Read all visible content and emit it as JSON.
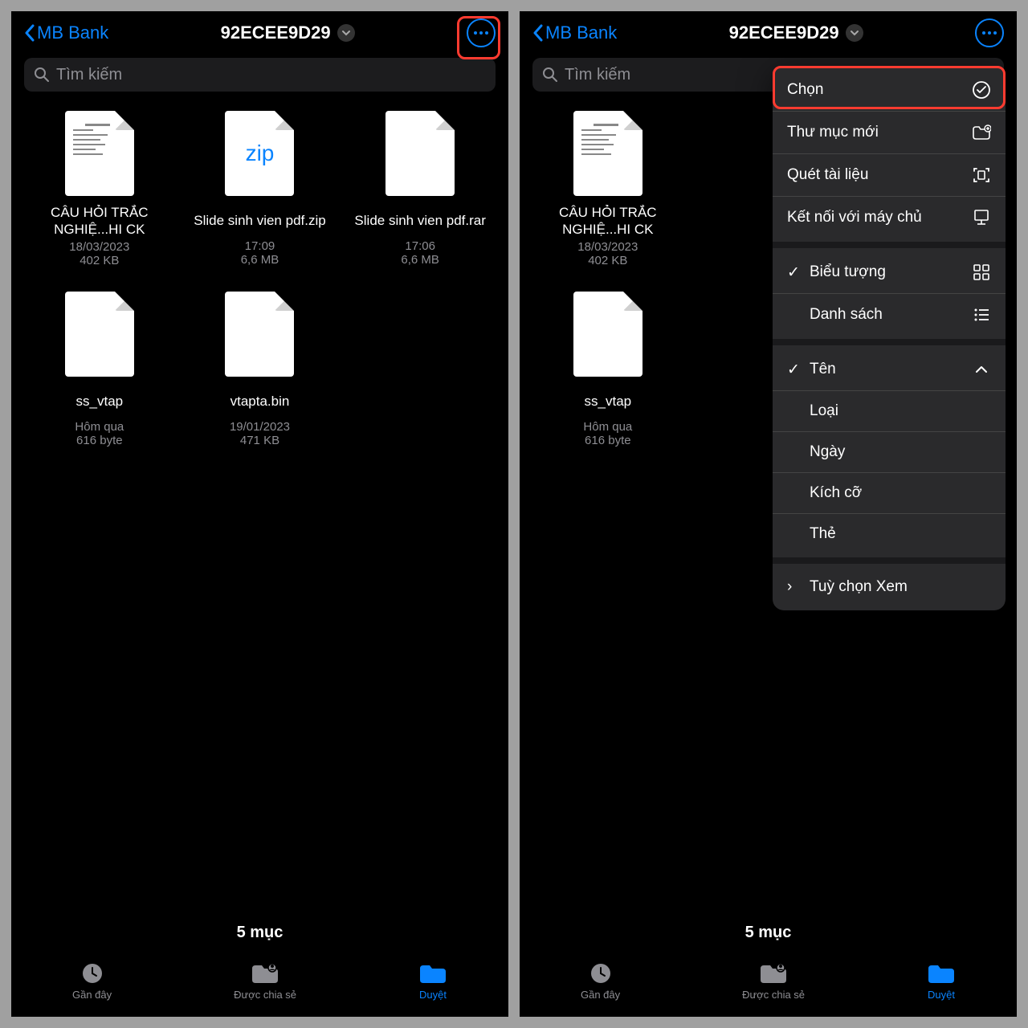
{
  "header": {
    "back_label": "MB Bank",
    "title": "92ECEE9D29"
  },
  "search": {
    "placeholder": "Tìm kiếm"
  },
  "files": [
    {
      "name": "CÂU HỎI TRẮC NGHIỆ...HI CK",
      "date": "18/03/2023",
      "size": "402 KB",
      "type": "doc"
    },
    {
      "name": "Slide sinh vien pdf.zip",
      "date": "17:09",
      "size": "6,6 MB",
      "type": "zip"
    },
    {
      "name": "Slide sinh vien pdf.rar",
      "date": "17:06",
      "size": "6,6 MB",
      "type": "blank"
    },
    {
      "name": "ss_vtap",
      "date": "Hôm qua",
      "size": "616 byte",
      "type": "blank"
    },
    {
      "name": "vtapta.bin",
      "date": "19/01/2023",
      "size": "471 KB",
      "type": "blank"
    }
  ],
  "footer_count": "5 mục",
  "tabs": [
    {
      "label": "Gần đây"
    },
    {
      "label": "Được chia sẻ"
    },
    {
      "label": "Duyệt"
    }
  ],
  "menu": {
    "section1": [
      {
        "label": "Chọn",
        "icon": "check-circle"
      },
      {
        "label": "Thư mục mới",
        "icon": "folder-plus"
      },
      {
        "label": "Quét tài liệu",
        "icon": "scan"
      },
      {
        "label": "Kết nối với máy chủ",
        "icon": "server"
      }
    ],
    "section2": [
      {
        "label": "Biểu tượng",
        "icon": "grid",
        "checked": true
      },
      {
        "label": "Danh sách",
        "icon": "list"
      }
    ],
    "section3": [
      {
        "label": "Tên",
        "checked": true,
        "chevron_up": true
      },
      {
        "label": "Loại"
      },
      {
        "label": "Ngày"
      },
      {
        "label": "Kích cỡ"
      },
      {
        "label": "Thẻ"
      }
    ],
    "section4": [
      {
        "label": "Tuỳ chọn Xem",
        "arrow": true
      }
    ]
  }
}
